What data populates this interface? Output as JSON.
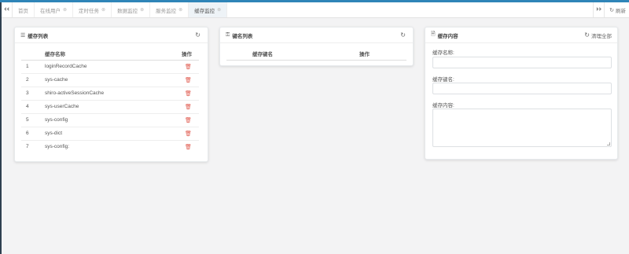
{
  "tabs": [
    {
      "label": "首页",
      "closable": false,
      "active": false
    },
    {
      "label": "在线用户",
      "closable": true,
      "active": false
    },
    {
      "label": "定时任务",
      "closable": true,
      "active": false
    },
    {
      "label": "数据监控",
      "closable": true,
      "active": false
    },
    {
      "label": "服务监控",
      "closable": true,
      "active": false
    },
    {
      "label": "缓存监控",
      "closable": true,
      "active": true
    }
  ],
  "toolbar": {
    "refresh_label": "刷新"
  },
  "cache_list": {
    "title": "缓存列表",
    "col_name": "缓存名称",
    "col_action": "操作",
    "rows": [
      {
        "index": "1",
        "name": "loginRecordCache"
      },
      {
        "index": "2",
        "name": "sys-cache"
      },
      {
        "index": "3",
        "name": "shiro-activeSessionCache"
      },
      {
        "index": "4",
        "name": "sys-userCache"
      },
      {
        "index": "5",
        "name": "sys-config"
      },
      {
        "index": "6",
        "name": "sys-dict"
      },
      {
        "index": "7",
        "name": "sys-config:"
      }
    ]
  },
  "key_list": {
    "title": "键名列表",
    "col_name": "缓存键名",
    "col_action": "操作"
  },
  "cache_content": {
    "title": "缓存内容",
    "clear_all_label": "清理全部",
    "name_label": "缓存名称:",
    "key_label": "缓存键名:",
    "content_label": "缓存内容:",
    "name_value": "",
    "key_value": "",
    "content_value": ""
  },
  "colors": {
    "accent": "#2f85b8",
    "sidebar": "#2f4050",
    "danger": "#e05a4e"
  }
}
